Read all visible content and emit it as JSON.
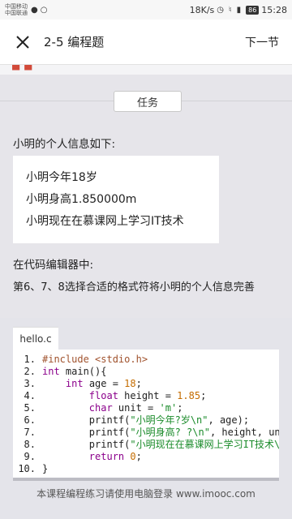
{
  "status_bar": {
    "carrier_line1": "中国移动",
    "carrier_line2": "中国联通",
    "speed": "18K/s",
    "battery": "86",
    "time": "15:28"
  },
  "app_bar": {
    "title": "2-5 编程题",
    "next_label": "下一节"
  },
  "task": {
    "button_label": "任务",
    "intro": "小明的个人信息如下:",
    "info_lines": [
      "小明今年18岁",
      "小明身高1.850000m",
      "小明现在在慕课网上学习IT技术"
    ],
    "instruction_1": "在代码编辑器中:",
    "instruction_2": "第6、7、8选择合适的格式符将小明的个人信息完善"
  },
  "editor": {
    "file_name": "hello.c",
    "code_lines": [
      {
        "n": "1.",
        "parts": [
          {
            "t": "#include <stdio.h>",
            "c": "pp"
          }
        ]
      },
      {
        "n": "2.",
        "parts": [
          {
            "t": "int",
            "c": "kw"
          },
          {
            "t": " main(){",
            "c": ""
          }
        ]
      },
      {
        "n": "3.",
        "parts": [
          {
            "t": "    ",
            "c": ""
          },
          {
            "t": "int",
            "c": "kw"
          },
          {
            "t": " age = ",
            "c": ""
          },
          {
            "t": "18",
            "c": "num"
          },
          {
            "t": ";",
            "c": ""
          }
        ]
      },
      {
        "n": "4.",
        "parts": [
          {
            "t": "        ",
            "c": ""
          },
          {
            "t": "float",
            "c": "kw"
          },
          {
            "t": " height = ",
            "c": ""
          },
          {
            "t": "1.85",
            "c": "num"
          },
          {
            "t": ";",
            "c": ""
          }
        ]
      },
      {
        "n": "5.",
        "parts": [
          {
            "t": "        ",
            "c": ""
          },
          {
            "t": "char",
            "c": "kw"
          },
          {
            "t": " unit = ",
            "c": ""
          },
          {
            "t": "'m'",
            "c": "str"
          },
          {
            "t": ";",
            "c": ""
          }
        ]
      },
      {
        "n": "6.",
        "parts": [
          {
            "t": "        printf(",
            "c": ""
          },
          {
            "t": "\"小明今年?岁\\n\"",
            "c": "str"
          },
          {
            "t": ", age);",
            "c": ""
          }
        ]
      },
      {
        "n": "7.",
        "parts": [
          {
            "t": "        printf(",
            "c": ""
          },
          {
            "t": "\"小明身高? ?\\n\"",
            "c": "str"
          },
          {
            "t": ", height, unit);",
            "c": ""
          }
        ]
      },
      {
        "n": "8.",
        "parts": [
          {
            "t": "        printf(",
            "c": ""
          },
          {
            "t": "\"小明现在在慕课网上学习IT技术\\n\"",
            "c": "str"
          },
          {
            "t": ");",
            "c": ""
          }
        ]
      },
      {
        "n": "9.",
        "parts": [
          {
            "t": "        ",
            "c": ""
          },
          {
            "t": "return",
            "c": "kw"
          },
          {
            "t": " ",
            "c": ""
          },
          {
            "t": "0",
            "c": "num"
          },
          {
            "t": ";",
            "c": ""
          }
        ]
      },
      {
        "n": "10.",
        "parts": [
          {
            "t": "}",
            "c": ""
          }
        ]
      }
    ]
  },
  "footer_text": "本课程编程练习请使用电脑登录 www.imooc.com",
  "colors": {
    "keyword": "#8b008b",
    "preprocessor": "#a0522d",
    "number": "#c46c00",
    "string": "#1a8b2a",
    "content_bg": "#e6e5ea"
  }
}
